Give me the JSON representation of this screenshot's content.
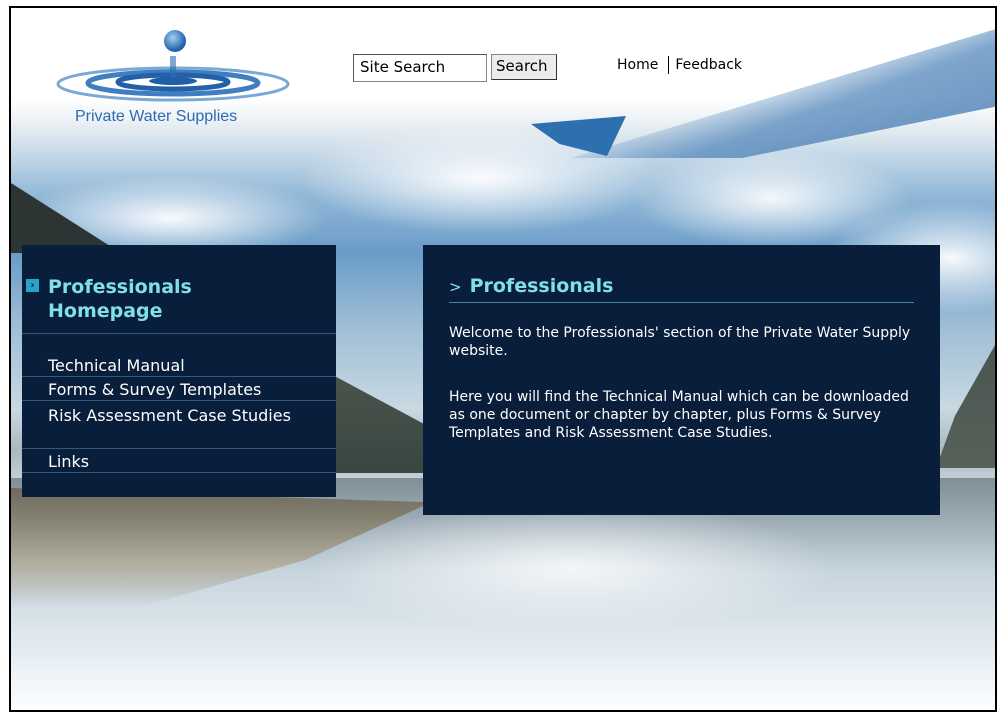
{
  "header": {
    "logo_text": "Private Water Supplies",
    "search": {
      "value": "Site Search",
      "button_label": "Search"
    },
    "nav": {
      "home": "Home",
      "feedback": "Feedback"
    }
  },
  "sidebar": {
    "home_label": "Professionals Homepage",
    "items": [
      {
        "label": "Technical Manual"
      },
      {
        "label": "Forms & Survey Templates"
      },
      {
        "label": "Risk Assessment Case Studies"
      },
      {
        "label": "Links"
      }
    ]
  },
  "main": {
    "heading": "Professionals",
    "heading_prefix": ">",
    "paragraphs": [
      "Welcome to the Professionals' section of the Private Water Supply website.",
      "Here you will find the Technical Manual which can be downloaded as one document or chapter by chapter, plus Forms & Survey Templates and Risk Assessment Case Studies."
    ]
  },
  "colors": {
    "panel_bg": "#081e3a",
    "heading_cyan": "#7fe0e6",
    "logo_blue": "#2a6bb0"
  }
}
